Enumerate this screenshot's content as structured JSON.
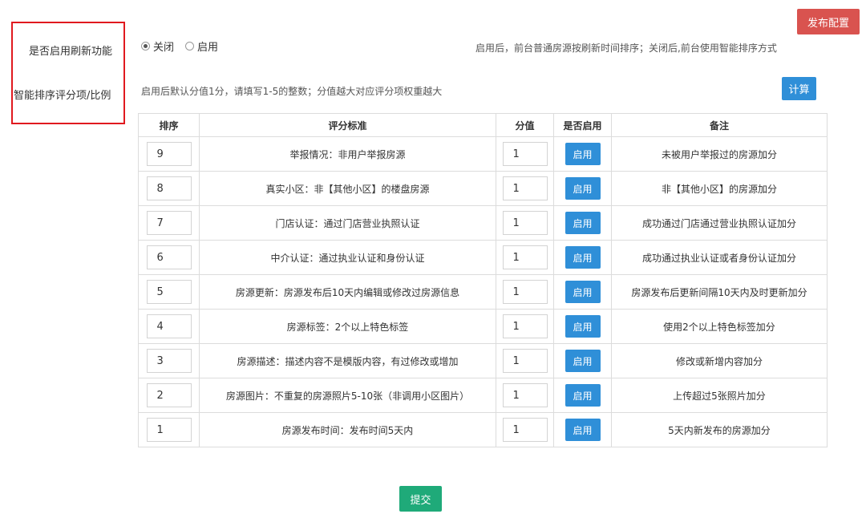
{
  "header": {
    "publish_label": "发布配置"
  },
  "refresh": {
    "label": "是否启用刷新功能",
    "option_off": "关闭",
    "option_on": "启用",
    "selected": "关闭",
    "hint": "启用后，前台普通房源按刷新时间排序；关闭后,前台使用智能排序方式"
  },
  "scoring": {
    "label": "智能排序评分项/比例",
    "hint": "启用后默认分值1分，请填写1-5的整数；分值越大对应评分项权重越大",
    "calc_label": "计算"
  },
  "table": {
    "headers": [
      "排序",
      "评分标准",
      "分值",
      "是否启用",
      "备注"
    ],
    "rows": [
      {
        "order": "9",
        "criterion": "举报情况：非用户举报房源",
        "score": "1",
        "enable": "启用",
        "note": "未被用户举报过的房源加分"
      },
      {
        "order": "8",
        "criterion": "真实小区：非【其他小区】的楼盘房源",
        "score": "1",
        "enable": "启用",
        "note": "非【其他小区】的房源加分"
      },
      {
        "order": "7",
        "criterion": "门店认证：通过门店营业执照认证",
        "score": "1",
        "enable": "启用",
        "note": "成功通过门店通过营业执照认证加分"
      },
      {
        "order": "6",
        "criterion": "中介认证：通过执业认证和身份认证",
        "score": "1",
        "enable": "启用",
        "note": "成功通过执业认证或者身份认证加分"
      },
      {
        "order": "5",
        "criterion": "房源更新：房源发布后10天内编辑或修改过房源信息",
        "score": "1",
        "enable": "启用",
        "note": "房源发布后更新间隔10天内及时更新加分"
      },
      {
        "order": "4",
        "criterion": "房源标签：2个以上特色标签",
        "score": "1",
        "enable": "启用",
        "note": "使用2个以上特色标签加分"
      },
      {
        "order": "3",
        "criterion": "房源描述：描述内容不是模版内容，有过修改或增加",
        "score": "1",
        "enable": "启用",
        "note": "修改或新增内容加分"
      },
      {
        "order": "2",
        "criterion": "房源图片：不重复的房源照片5-10张（非调用小区图片）",
        "score": "1",
        "enable": "启用",
        "note": "上传超过5张照片加分"
      },
      {
        "order": "1",
        "criterion": "房源发布时间：发布时间5天内",
        "score": "1",
        "enable": "启用",
        "note": "5天内新发布的房源加分"
      }
    ]
  },
  "footer": {
    "submit_label": "提交"
  }
}
